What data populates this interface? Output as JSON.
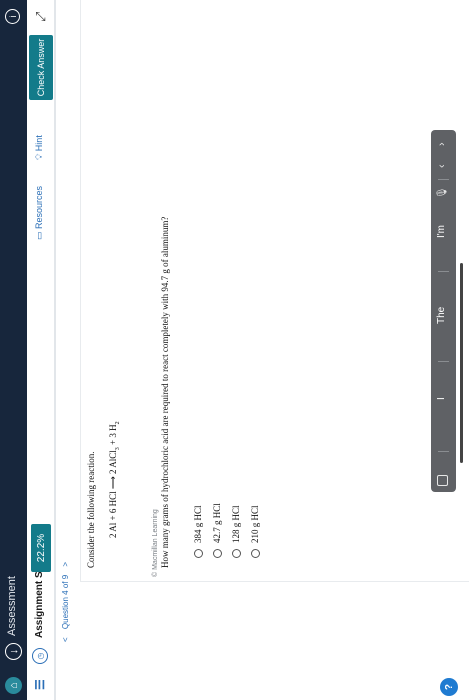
{
  "header": {
    "title": "Assessment",
    "home_icon": "home-icon",
    "back_icon": "back-arrow-icon",
    "info_icon": "info-icon"
  },
  "scorebar": {
    "menu_label": "☰",
    "score_label": "Assignment Score:",
    "score_value": "22.2%",
    "resources_label": "Resources",
    "hint_label": "Hint",
    "check_answer_label": "Check Answer",
    "expand_icon": "expand-icon"
  },
  "question_nav": {
    "prev": "<",
    "label": "Question 4 of 9",
    "next": ">"
  },
  "card": {
    "copyright": "© Macmillan Learning",
    "prompt": "Consider the following reaction.",
    "reaction": {
      "left": "2 Al + 6 HCl",
      "arrow": "⟶",
      "product1": "2 AlCl",
      "product1_sub": "3",
      "plus": "+ 3 H",
      "product2_sub": "2"
    },
    "question": "How many grams of hydrochloric acid are required to react completely with 94.7 g of aluminum?",
    "options": [
      "384 g HCl",
      "42.7 g HCl",
      "128 g HCl",
      "210 g HCl"
    ]
  },
  "keyboard_bar": {
    "suggestions": [
      "I",
      "The",
      "I'm"
    ]
  },
  "colors": {
    "header_bg": "#17263c",
    "accent_teal": "#137b8a",
    "link_blue": "#2b6fb7"
  }
}
